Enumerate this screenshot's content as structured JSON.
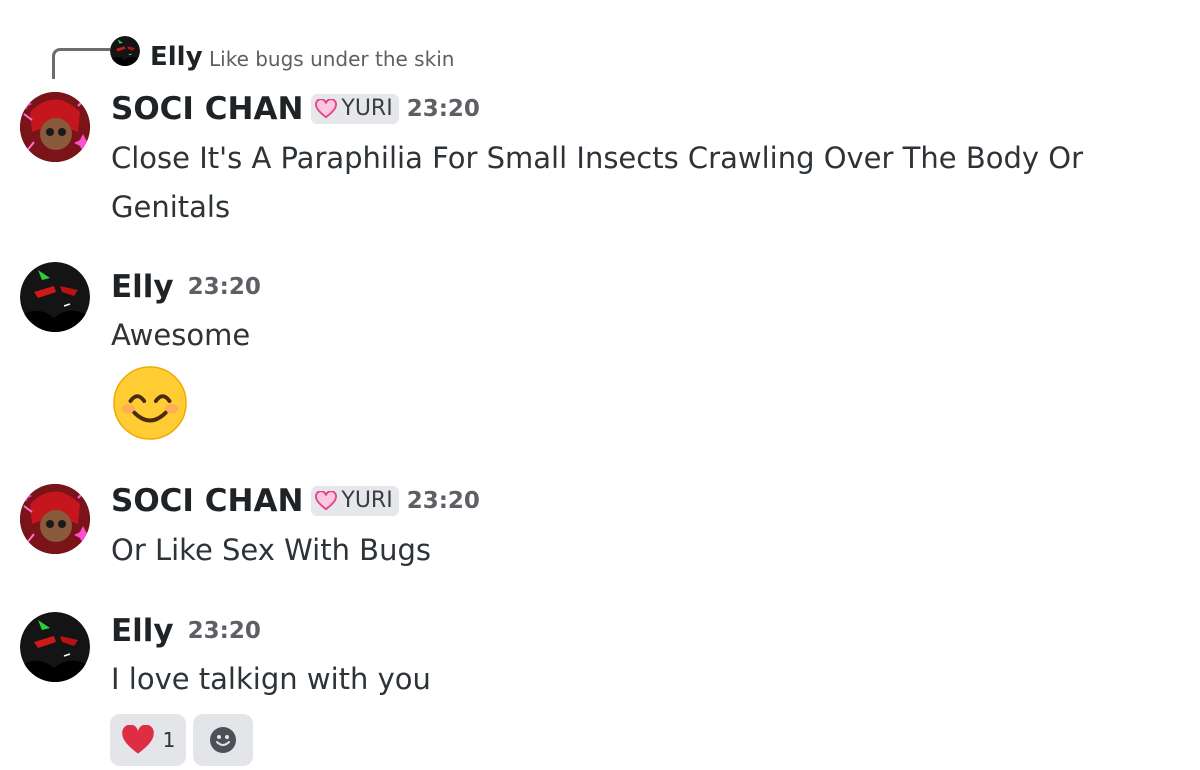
{
  "reply": {
    "author": "Elly",
    "text": "Like bugs under the skin"
  },
  "messages": [
    {
      "author": "SOCI CHAN",
      "tag": "YURI",
      "time": "23:20",
      "text_line1": "Close It's A Paraphilia For Small Insects Crawling Over The Body Or",
      "text_line2": "Genitals"
    },
    {
      "author": "Elly",
      "time": "23:20",
      "text": "Awesome",
      "emoji": "smiling-face-with-smiling-eyes"
    },
    {
      "author": "SOCI CHAN",
      "tag": "YURI",
      "time": "23:20",
      "text": "Or Like Sex With Bugs"
    },
    {
      "author": "Elly",
      "time": "23:20",
      "text": "I love talkign with you",
      "reactions": [
        {
          "emoji": "red-heart",
          "count": "1"
        },
        {
          "emoji": "add-reaction"
        }
      ]
    }
  ],
  "colors": {
    "author": "#1f2326",
    "timestamp": "#5c5f64",
    "tag_bg": "#e6e7ea",
    "reaction_bg": "#e3e5e8",
    "heart": "#dd2e44"
  }
}
